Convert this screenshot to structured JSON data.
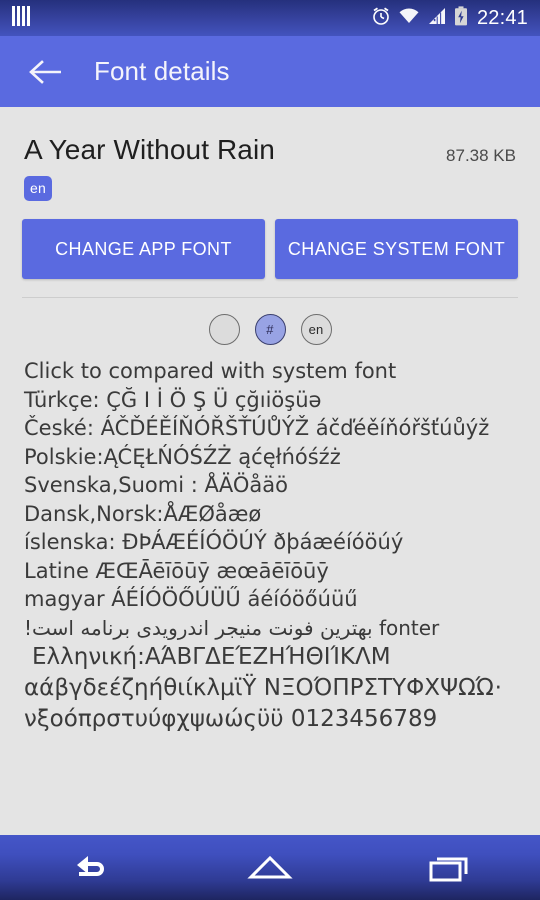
{
  "statusbar": {
    "clock": "22:41",
    "icons": {
      "app_notification": "barcode-icon",
      "alarm": "alarm-clock-icon",
      "wifi": "wifi-icon",
      "signal": "cellular-signal-icon",
      "battery": "battery-charging-icon"
    }
  },
  "appbar": {
    "title": "Font details",
    "back": "back-arrow-icon",
    "color": "#5a6ae0"
  },
  "details": {
    "font_name": "A Year Without Rain",
    "file_size": "87.38 KB",
    "language_badge": "en"
  },
  "actions": {
    "change_app_font": "CHANGE APP FONT",
    "change_system_font": "CHANGE SYSTEM FONT"
  },
  "chips": [
    {
      "label": "",
      "name": "chip-blank",
      "selected": false
    },
    {
      "label": "#",
      "name": "chip-numeric",
      "selected": true
    },
    {
      "label": "en",
      "name": "chip-en",
      "selected": false
    }
  ],
  "preview": {
    "lines": [
      "Click to compared with system font",
      "Türkçe: ÇĞ I İ Ö Ş Ü  çğıiöşüə",
      "České: ÁČĎÉĚÍŇÓŘŠŤÚŮÝŽ áčďéěíňóřšťúůýž",
      "Polskie:ĄĆĘŁŃÓŚŹŻ ąćęłńóśźż",
      "Svenska,Suomi :  ÅÄÖåäö",
      "Dansk,Norsk:ÅÆØåæø",
      "íslenska: ÐÞÁÆÉÍÓÖÚÝ ðþáæéíóöúý",
      "Latine ÆŒĀēīōūȳ æœāēīōūȳ",
      "magyar ÁÉÍÓÖŐÚÜŰ áéíóöőúüű",
      "fonter بهترین فونت منیجر اندرویدی برنامه است!",
      "Ελληνική:ΑΆΒΓΔΕΈΖΗΉΘΙΊΚΛΜ",
      "αάβγδεέζηήθιίκλμϊΫ ΝΞΟΌΠΡΣΤΥΦΧΨΩΏ·",
      "νξοόπρστυύφχψωώςϋϋ 0123456789"
    ]
  },
  "navbar": {
    "back": "back-navigation-icon",
    "home": "home-navigation-icon",
    "recents": "recent-apps-icon"
  }
}
